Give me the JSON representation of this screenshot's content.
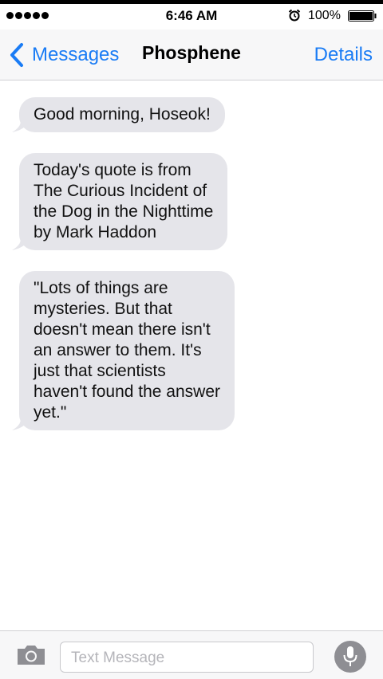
{
  "status_bar": {
    "time": "6:46 AM",
    "battery_percent": "100%",
    "signal_icon": "signal-dots-icon",
    "alarm_icon": "alarm-clock-icon",
    "battery_icon": "battery-full-icon"
  },
  "nav": {
    "back_label": "Messages",
    "back_icon": "chevron-left-icon",
    "title": "Phosphene",
    "details_label": "Details",
    "accent_color": "#1a7cf5"
  },
  "messages": [
    {
      "direction": "incoming",
      "text": "Good morning, Hoseok!"
    },
    {
      "direction": "incoming",
      "text": "Today's quote is from\nThe Curious Incident of\nthe Dog in the Nighttime\nby Mark Haddon"
    },
    {
      "direction": "incoming",
      "text": "\"Lots of things are\nmysteries. But that\ndoesn't mean there isn't\nan answer to them. It's\njust that scientists\nhaven't found the answer\nyet.\""
    }
  ],
  "input_bar": {
    "placeholder": "Text Message",
    "camera_icon": "camera-icon",
    "mic_icon": "microphone-icon"
  },
  "colors": {
    "incoming_bubble": "#e5e5ea",
    "bar_background": "#f7f7f8"
  }
}
